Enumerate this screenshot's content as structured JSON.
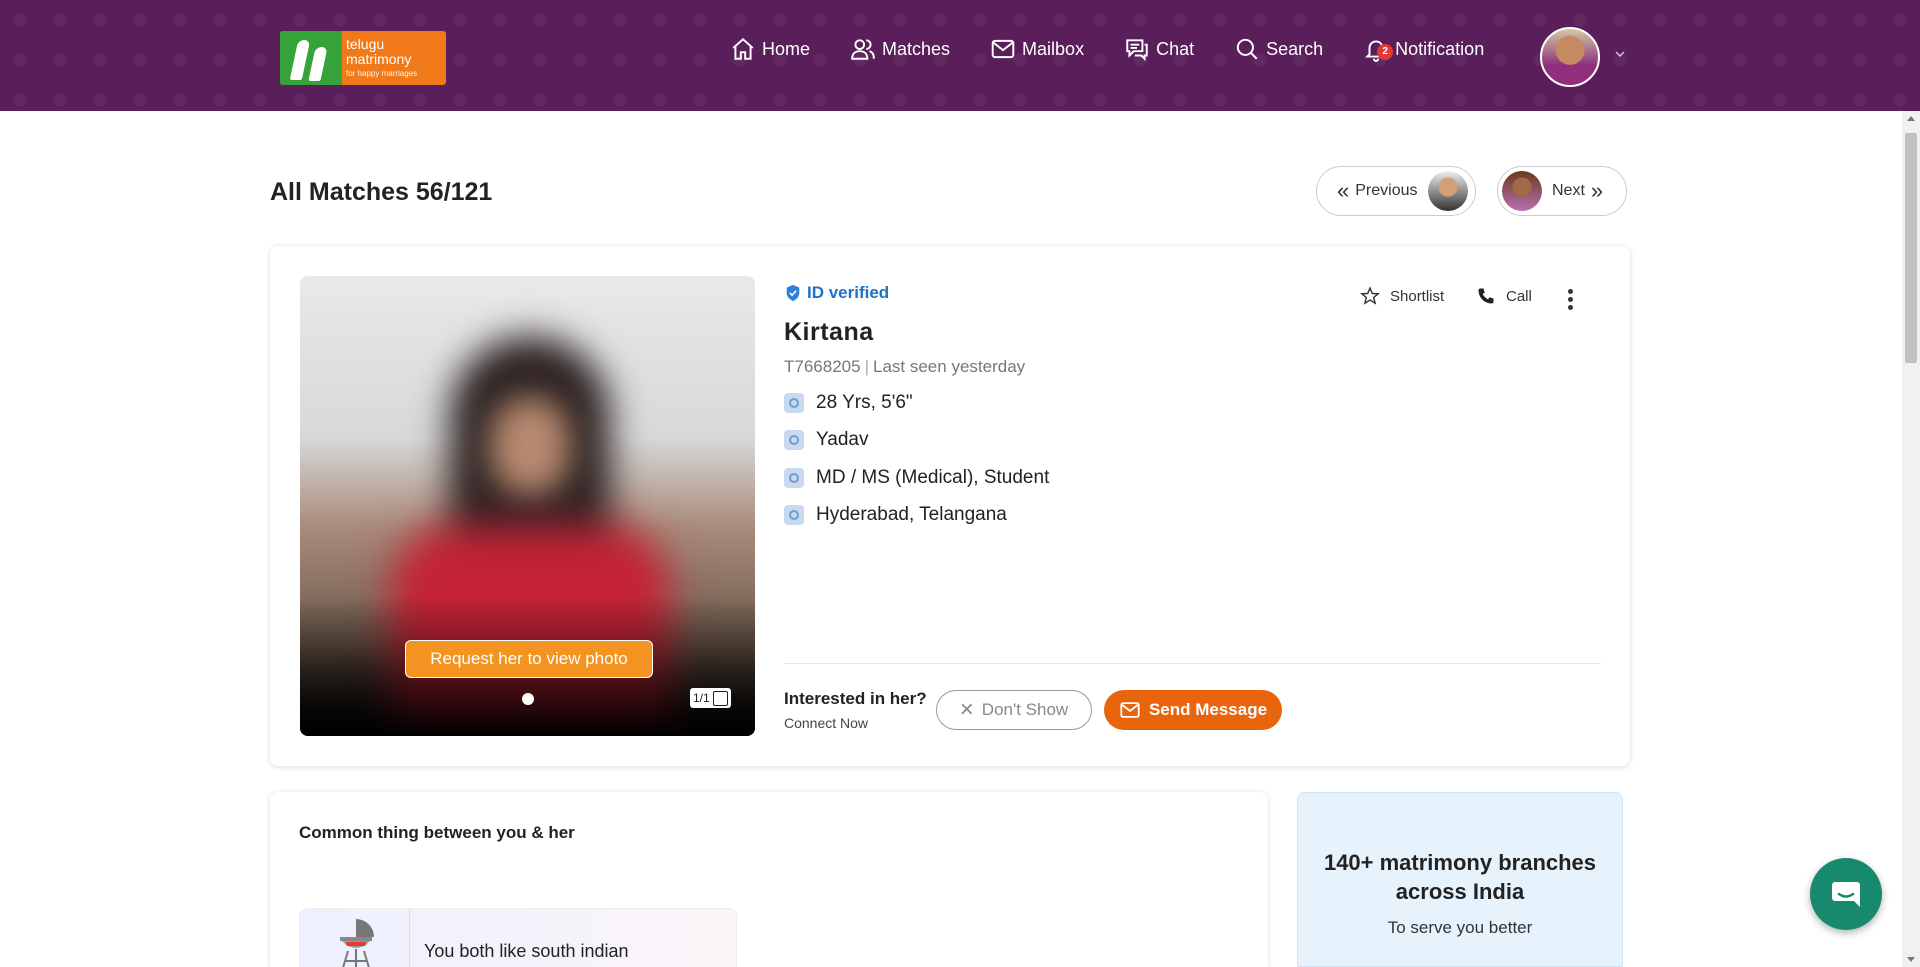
{
  "header": {
    "logo": {
      "line1": "telugu",
      "line2": "matrimony",
      "tagline": "for happy marriages"
    },
    "nav": [
      {
        "label": "Home",
        "icon": "home-icon"
      },
      {
        "label": "Matches",
        "icon": "users-icon"
      },
      {
        "label": "Mailbox",
        "icon": "mail-icon"
      },
      {
        "label": "Chat",
        "icon": "chat-icon"
      },
      {
        "label": "Search",
        "icon": "search-icon"
      },
      {
        "label": "Notification",
        "icon": "bell-icon",
        "badge": "2"
      }
    ]
  },
  "page": {
    "title": "All Matches 56/121",
    "previous_label": "Previous",
    "next_label": "Next"
  },
  "profile": {
    "verified_label": "ID verified",
    "name": "Kirtana",
    "id": "T7668205",
    "last_seen": "Last seen yesterday",
    "attributes": [
      {
        "icon": "age-icon",
        "text": "28 Yrs, 5'6\""
      },
      {
        "icon": "community-icon",
        "text": "Yadav"
      },
      {
        "icon": "education-icon",
        "text": "MD / MS (Medical), Student"
      },
      {
        "icon": "location-icon",
        "text": "Hyderabad, Telangana"
      }
    ],
    "photo_request_label": "Request her to view photo",
    "photo_counter": "1/1",
    "shortlist_label": "Shortlist",
    "call_label": "Call",
    "interest_question": "Interested in her?",
    "interest_sub": "Connect Now",
    "dont_show_label": "Don't Show",
    "send_message_label": "Send Message"
  },
  "common": {
    "title": "Common thing between you & her",
    "item_text": "You both like south indian"
  },
  "branches": {
    "heading": "140+ matrimony branches across India",
    "sub": "To serve you better"
  },
  "colors": {
    "header_bg": "#5a1f5b",
    "accent_orange": "#e8650e",
    "verified_blue": "#1a73c8",
    "chat_fab": "#178a6d"
  }
}
